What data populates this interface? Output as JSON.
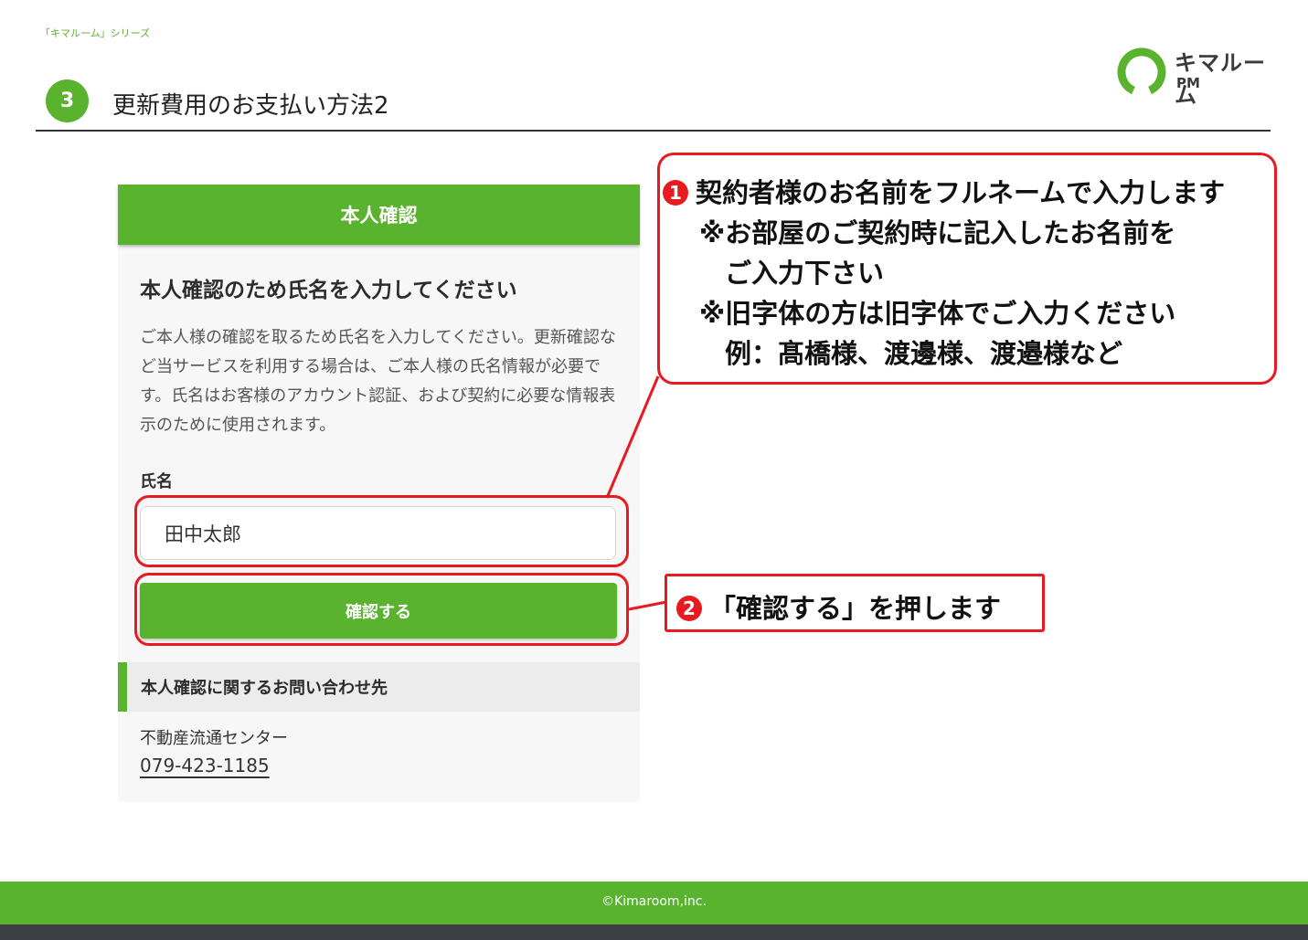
{
  "header": {
    "series": "「キマルーム」シリーズ",
    "step": "3",
    "title": "更新費用のお支払い方法2",
    "logo_name": "キマルーム",
    "logo_sub": "PM"
  },
  "card": {
    "header_title": "本人確認",
    "heading": "本人確認のため氏名を入力してください",
    "description": "ご本人様の確認を取るため氏名を入力してください。更新確認など当サービスを利用する場合は、ご本人様の氏名情報が必要です。氏名はお客様のアカウント認証、および契約に必要な情報表示のために使用されます。",
    "name_label": "氏名",
    "name_value": "田中太郎",
    "confirm_button": "確認する",
    "contact_heading": "本人確認に関するお問い合わせ先",
    "contact_org": "不動産流通センター",
    "contact_tel": "079-423-1185"
  },
  "callouts": {
    "c1_num": "1",
    "c1_line1": "契約者様のお名前をフルネームで入力します",
    "c1_line2": "※お部屋のご契約時に記入したお名前を",
    "c1_line3": "ご入力下さい",
    "c1_line4": "※旧字体の方は旧字体でご入力ください",
    "c1_line5": "例：髙橋様、渡邊様、渡邉様など",
    "c2_num": "2",
    "c2_text": "「確認する」を押します"
  },
  "footer": {
    "copyright": "©Kimaroom,inc."
  },
  "colors": {
    "brand_green": "#5ab32e",
    "annotation_red": "#e8191f"
  }
}
